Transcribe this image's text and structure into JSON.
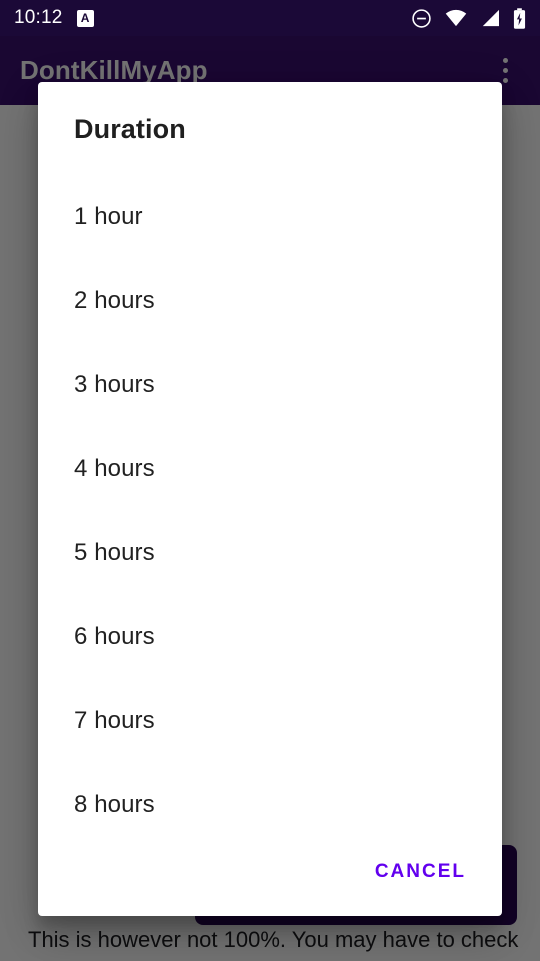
{
  "status_bar": {
    "clock": "10:12",
    "notification_badge": "A",
    "icons": [
      {
        "name": "do-not-disturb-icon",
        "glyph": "⊖"
      },
      {
        "name": "wifi-icon",
        "glyph": "wifi"
      },
      {
        "name": "cellular-signal-icon",
        "glyph": "signal"
      },
      {
        "name": "battery-charging-icon",
        "glyph": "battery"
      }
    ],
    "background_color": "#1b0937",
    "foreground_color": "#ffffff"
  },
  "app_bar": {
    "title": "DontKillMyApp",
    "overflow_menu_label": "More options",
    "background_color": "#3b1070"
  },
  "background_page": {
    "footer_text": "This is however not 100%. You may have to check",
    "button_color": "#2c0b57",
    "lines": [
      "",
      "",
      "",
      "",
      "",
      "",
      "",
      "",
      "",
      "",
      "",
      "",
      "",
      "",
      "",
      "",
      "",
      "",
      "",
      "",
      "",
      "",
      "",
      "",
      ""
    ]
  },
  "dialog": {
    "title": "Duration",
    "options": [
      "1 hour",
      "2 hours",
      "3 hours",
      "4 hours",
      "5 hours",
      "6 hours",
      "7 hours",
      "8 hours"
    ],
    "cancel_label": "CANCEL",
    "accent_color": "#6200ee",
    "surface_color": "#ffffff"
  },
  "scrim": {
    "color": "rgba(0,0,0,0.55)"
  }
}
